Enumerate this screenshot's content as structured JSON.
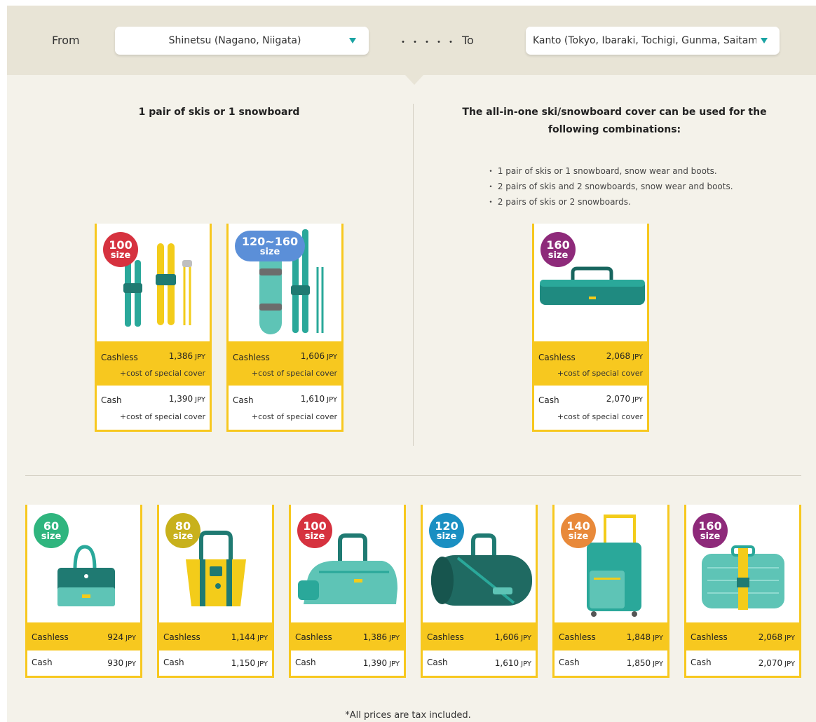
{
  "route": {
    "from_label": "From",
    "from_value": "Shinetsu (Nagano, Niigata)",
    "dots": "・・・・・",
    "to_label": "To",
    "to_value": "Kanto (Tokyo, Ibaraki, Tochigi, Gunma, Saitama"
  },
  "ski": {
    "left_heading": "1 pair of skis or 1 snowboard",
    "right_heading_1": "The all-in-one ski/snowboard cover can be used for the",
    "right_heading_2": "following combinations:",
    "bullets": [
      "・ 1 pair of skis or 1 snowboard, snow wear and boots.",
      "・ 2 pairs of skis and 2 snowboards, snow wear and boots.",
      "・ 2 pairs of skis or 2 snowboards."
    ],
    "cards": [
      {
        "size": "100",
        "size_word": "size",
        "badge_color": "#d6323f",
        "cashless_label": "Cashless",
        "cashless": "1,386",
        "cash_label": "Cash",
        "cash": "1,390",
        "currency": "JPY",
        "note": "+cost of special cover",
        "icon": "skis-and-poles-icon"
      },
      {
        "size": "120~160",
        "size_word": "size",
        "badge_color": "#5b8fd8",
        "cashless_label": "Cashless",
        "cashless": "1,606",
        "cash_label": "Cash",
        "cash": "1,610",
        "currency": "JPY",
        "note": "+cost of special cover",
        "icon": "snowboard-and-skis-icon"
      },
      {
        "size": "160",
        "size_word": "size",
        "badge_color": "#8e2a7a",
        "cashless_label": "Cashless",
        "cashless": "2,068",
        "cash_label": "Cash",
        "cash": "2,070",
        "currency": "JPY",
        "note": "+cost of special cover",
        "icon": "ski-cover-bag-icon"
      }
    ]
  },
  "bags": [
    {
      "size": "60",
      "size_word": "size",
      "badge_color": "#2fb57e",
      "cashless_label": "Cashless",
      "cashless": "924",
      "cash_label": "Cash",
      "cash": "930",
      "currency": "JPY",
      "icon": "handbag-icon"
    },
    {
      "size": "80",
      "size_word": "size",
      "badge_color": "#c8b11c",
      "cashless_label": "Cashless",
      "cashless": "1,144",
      "cash_label": "Cash",
      "cash": "1,150",
      "currency": "JPY",
      "icon": "tote-bag-icon"
    },
    {
      "size": "100",
      "size_word": "size",
      "badge_color": "#d6323f",
      "cashless_label": "Cashless",
      "cashless": "1,386",
      "cash_label": "Cash",
      "cash": "1,390",
      "currency": "JPY",
      "icon": "sports-bag-icon"
    },
    {
      "size": "120",
      "size_word": "size",
      "badge_color": "#1a8fc2",
      "cashless_label": "Cashless",
      "cashless": "1,606",
      "cash_label": "Cash",
      "cash": "1,610",
      "currency": "JPY",
      "icon": "duffel-bag-icon"
    },
    {
      "size": "140",
      "size_word": "size",
      "badge_color": "#e8893a",
      "cashless_label": "Cashless",
      "cashless": "1,848",
      "cash_label": "Cash",
      "cash": "1,850",
      "currency": "JPY",
      "icon": "suitcase-trolley-icon"
    },
    {
      "size": "160",
      "size_word": "size",
      "badge_color": "#8e2a7a",
      "cashless_label": "Cashless",
      "cashless": "2,068",
      "cash_label": "Cash",
      "cash": "2,070",
      "currency": "JPY",
      "icon": "large-suitcase-icon"
    }
  ],
  "footer_note": "*All prices are tax included."
}
